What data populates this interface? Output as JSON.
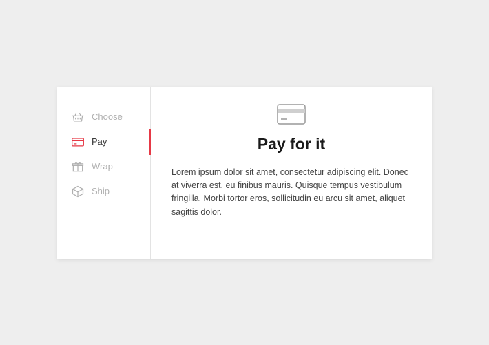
{
  "sidebar": {
    "items": [
      {
        "label": "Choose",
        "icon": "basket-icon"
      },
      {
        "label": "Pay",
        "icon": "credit-card-icon"
      },
      {
        "label": "Wrap",
        "icon": "gift-icon"
      },
      {
        "label": "Ship",
        "icon": "box-icon"
      }
    ],
    "activeIndex": 1
  },
  "content": {
    "title": "Pay for it",
    "body": "Lorem ipsum dolor sit amet, consectetur adipiscing elit. Donec at viverra est, eu finibus mauris. Quisque tempus vestibulum fringilla. Morbi tortor eros, sollicitudin eu arcu sit amet, aliquet sagittis dolor."
  },
  "colors": {
    "accent": "#e63946",
    "iconGray": "#b0b0b0",
    "textGray": "#444"
  }
}
